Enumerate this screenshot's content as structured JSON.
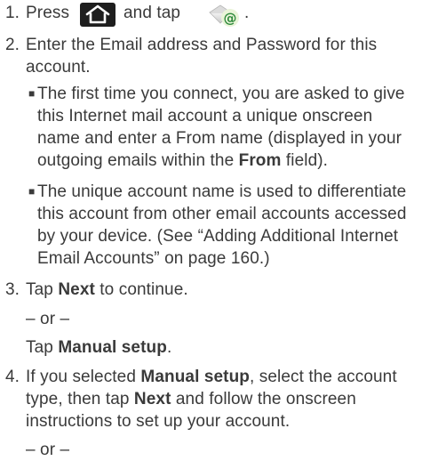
{
  "step1": {
    "number": "1.",
    "text_before": "Press",
    "text_middle": "and tap",
    "text_after": "."
  },
  "step2": {
    "number": "2.",
    "line1": "Enter the Email address and Password for this",
    "line2": "account.",
    "bullets": [
      {
        "lines": [
          "The first time you connect, you are asked to give",
          "this Internet mail account a unique onscreen",
          "name and enter a From name (displayed in your"
        ],
        "last_before": "outgoing emails within the ",
        "last_bold": "From",
        "last_after": " field)."
      },
      {
        "lines": [
          "The unique account name is used to differentiate",
          "this account from other email accounts accessed",
          "by your device. (See “Adding Additional Internet",
          "Email Accounts” on page 160.)"
        ]
      }
    ]
  },
  "step3": {
    "number": "3.",
    "before": "Tap ",
    "bold": "Next",
    "after": " to continue.",
    "or": "– or –",
    "alt_before": "Tap ",
    "alt_bold": "Manual setup",
    "alt_after": "."
  },
  "step4": {
    "number": "4.",
    "l1_before": "If you selected ",
    "l1_bold": "Manual setup",
    "l1_after": ", select the account",
    "l2_before": "type, then tap ",
    "l2_bold": "Next",
    "l2_after": " and follow the onscreen",
    "l3": "instructions to set up your account.",
    "or": "– or –"
  },
  "icons": [
    "home-icon",
    "email-app-icon"
  ],
  "colors": {
    "text": "#3a3a3a",
    "icon_dark": "#1e1e1e",
    "email_green": "#2f8a3c"
  }
}
